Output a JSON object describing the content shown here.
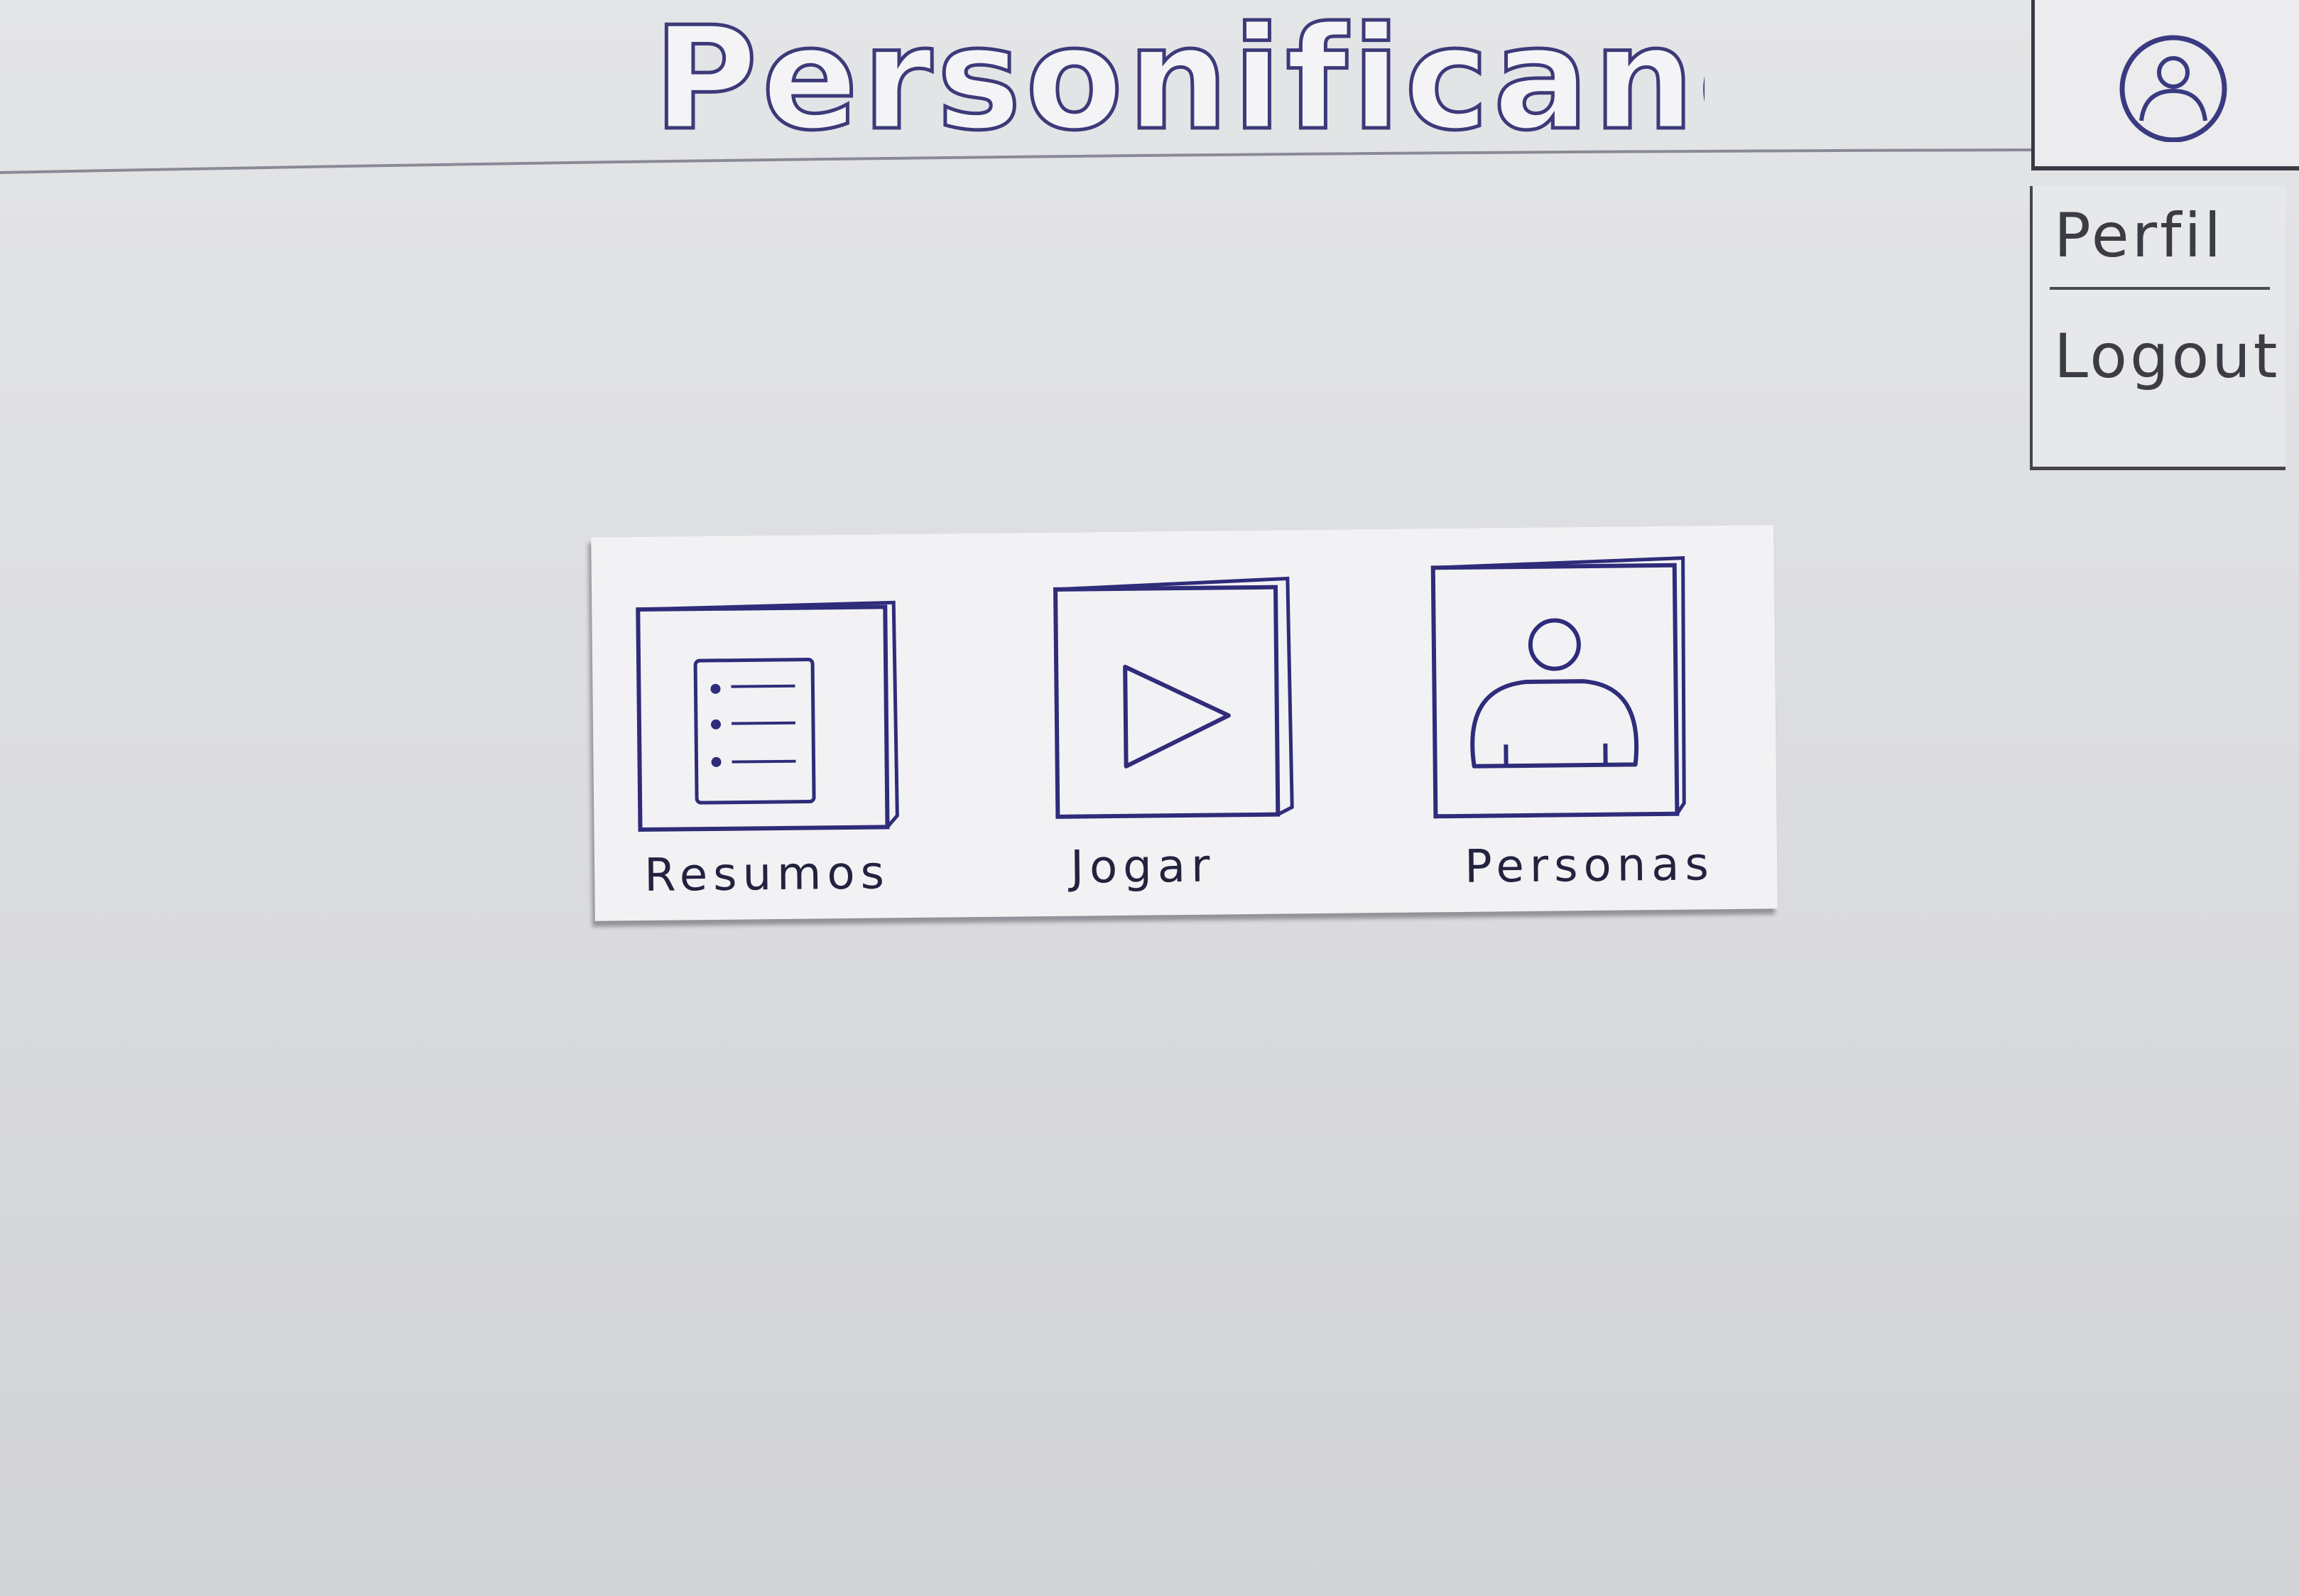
{
  "header": {
    "app_title": "Personificando"
  },
  "account": {
    "profile_icon": "user-circle-icon",
    "menu": {
      "perfil_label": "Perfil",
      "logout_label": "Logout"
    }
  },
  "tiles": [
    {
      "label": "Resumos",
      "icon": "document-list-icon"
    },
    {
      "label": "Jogar",
      "icon": "play-icon"
    },
    {
      "label": "Personas",
      "icon": "person-icon"
    }
  ],
  "colors": {
    "ink": "#2b2a5e",
    "paper": "#f2f2f4",
    "background": "#dcdde0"
  }
}
